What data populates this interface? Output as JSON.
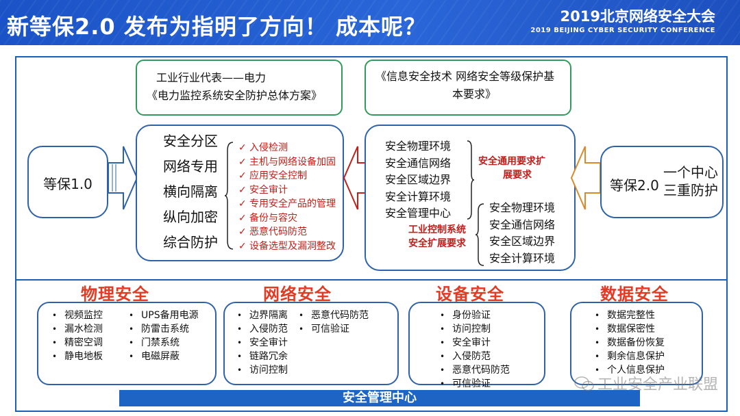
{
  "header": {
    "title": "新等保2.0 发布为指明了方向！   成本呢？",
    "conference_cn": "2019北京网络安全大会",
    "conference_en": "2019 BEIJING CYBER SECURITY CONFERENCE"
  },
  "left_box": {
    "label": "等保1.0"
  },
  "right_box": {
    "label": "等保2.0",
    "desc_line1": "一个中心",
    "desc_line2": "三重防护"
  },
  "green_left": {
    "line1": "工业行业代表——电力",
    "line2": "《电力监控系统安全防护总体方案》"
  },
  "green_right": {
    "line1": "《信息安全技术 网络安全等级保护基",
    "line2": "本要求》"
  },
  "power_box": {
    "principles": [
      "安全分区",
      "网络专用",
      "横向隔离",
      "纵向加密",
      "综合防护"
    ],
    "requirements": [
      "入侵检测",
      "主机与网络设备加固",
      "应用安全控制",
      "安全审计",
      "专用安全产品的管理",
      "备份与容灾",
      "恶意代码防范",
      "设备选型及漏洞整改"
    ]
  },
  "standard_box": {
    "general_items": [
      "安全物理环境",
      "安全通信网络",
      "安全区域边界",
      "安全计算环境",
      "安全管理中心"
    ],
    "general_label": "安全通用要求扩展要求",
    "general_label_line1": "安全通用要求扩",
    "general_label_line2": "展要求",
    "ics_label_line1": "工业控制系统",
    "ics_label_line2": "安全扩展要求",
    "ics_items": [
      "安全物理环境",
      "安全通信网络",
      "安全区域边界",
      "安全计算环境"
    ]
  },
  "categories": [
    {
      "title": "物理安全",
      "col1": [
        "视频监控",
        "漏水检测",
        "精密空调",
        "静电地板"
      ],
      "col2": [
        "UPS备用电源",
        "防雷击系统",
        "门禁系统",
        "电磁屏蔽"
      ]
    },
    {
      "title": "网络安全",
      "col1": [
        "边界隔离",
        "入侵防范",
        "安全审计",
        "链路冗余",
        "访问控制"
      ],
      "col2": [
        "恶意代码防范",
        "可信验证"
      ]
    },
    {
      "title": "设备安全",
      "col1": [
        "身份验证",
        "访问控制",
        "安全审计",
        "入侵防范",
        "恶意代码防范",
        "可信验证"
      ]
    },
    {
      "title": "数据安全",
      "col1": [
        "数据完整性",
        "数据保密性",
        "数据备份恢复",
        "剩余信息保护",
        "个人信息保护"
      ]
    }
  ],
  "bottom_bar": {
    "label": "安全管理中心"
  },
  "watermark": {
    "text": "工业安全产业联盟"
  },
  "colors": {
    "header_blue": "#1a53c5",
    "frame_blue": "#1c5fb8",
    "accent_red": "#c0201b",
    "category_red": "#e23b24",
    "green_border": "#2f9a5a"
  }
}
